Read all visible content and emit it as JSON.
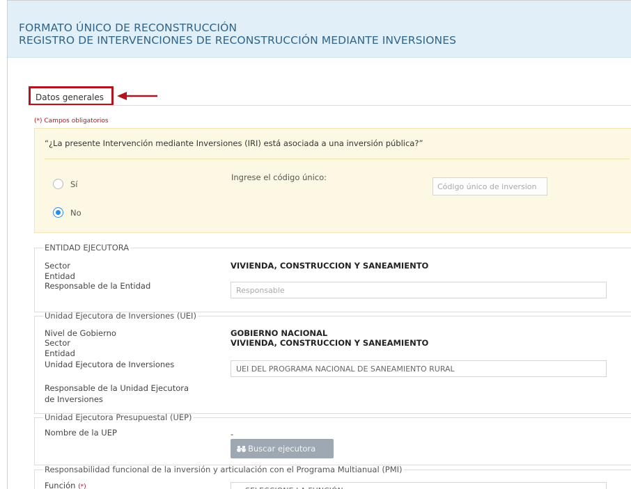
{
  "header": {
    "line1": "FORMATO ÚNICO DE RECONSTRUCCIÓN",
    "line2": "REGISTRO DE INTERVENCIONES DE RECONSTRUCCIÓN MEDIANTE INVERSIONES"
  },
  "tab": {
    "label": "Datos generales"
  },
  "required_note": "(*) Campos obligatorios",
  "question": {
    "text": "“¿La presente Intervención mediante Inversiones (IRI) está asociada a una inversión pública?”",
    "options": [
      {
        "label": "Sí",
        "selected": false
      },
      {
        "label": "No",
        "selected": true
      }
    ],
    "code_label": "Ingrese el código único:",
    "code_placeholder": "Código único de inversion"
  },
  "entidad_ejecutora": {
    "legend": "ENTIDAD EJECUTORA",
    "sector_label": "Sector",
    "sector_value": "VIVIENDA, CONSTRUCCION Y SANEAMIENTO",
    "entidad_label": "Entidad",
    "responsable_label": "Responsable de la Entidad",
    "responsable_placeholder": "Responsable"
  },
  "uei": {
    "legend": "Unidad Ejecutora de Inversiones (UEI)",
    "nivel_label": "Nivel de Gobierno",
    "nivel_value": "GOBIERNO NACIONAL",
    "sector_label": "Sector",
    "sector_value": "VIVIENDA, CONSTRUCCION Y SANEAMIENTO",
    "entidad_label": "Entidad",
    "uei_label": "Unidad Ejecutora de Inversiones",
    "uei_value": "UEI DEL PROGRAMA NACIONAL DE SANEAMIENTO RURAL",
    "responsable_label_1": "Responsable de la Unidad Ejecutora",
    "responsable_label_2": "de Inversiones"
  },
  "uep": {
    "legend": "Unidad Ejecutora Presupuestal (UEP)",
    "nombre_label": "Nombre de la UEP",
    "nombre_value": "-",
    "buscar_button": "Buscar ejecutora"
  },
  "funcional": {
    "legend": "Responsabilidad funcional de la inversión y articulación con el Programa Multianual (PMI)",
    "funcion_label": "Función",
    "required_mark": "(*)",
    "funcion_value": "SELECCIONE LA FUNCIÓN"
  },
  "colors": {
    "header_bg": "#e1f0f8",
    "header_text": "#2f6388",
    "highlight_red": "#b0151d",
    "question_bg": "#fcf8e3",
    "radio_selected": "#2e8be0",
    "button_bg": "#9ea8b2"
  }
}
